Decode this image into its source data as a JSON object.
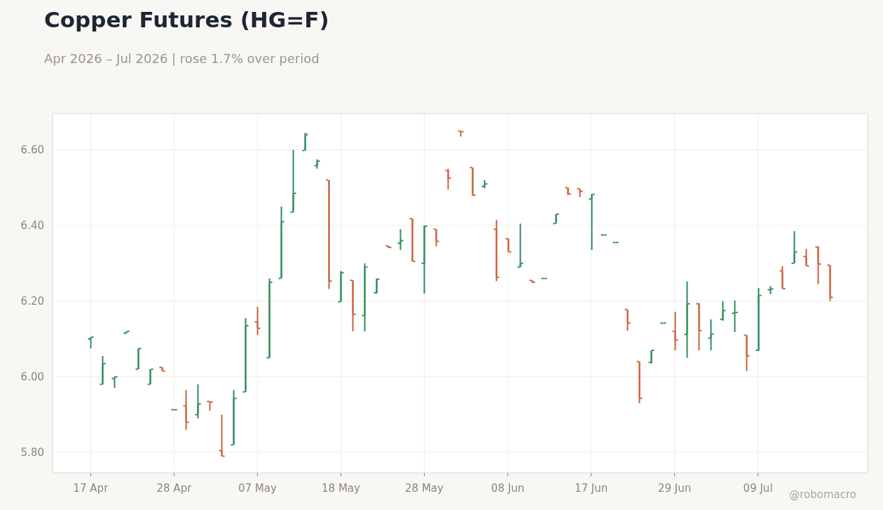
{
  "title": "Copper Futures (HG=F)",
  "subtitle": "Apr 2026 – Jul 2026 | rose 1.7% over period",
  "chart_data": {
    "type": "candlestick",
    "categories": [
      "17 Apr",
      null,
      null,
      null,
      null,
      null,
      null,
      "28 Apr",
      null,
      null,
      null,
      null,
      null,
      null,
      "07 May",
      null,
      null,
      null,
      null,
      null,
      null,
      "18 May",
      null,
      null,
      null,
      null,
      null,
      null,
      "28 May",
      null,
      null,
      null,
      null,
      null,
      null,
      "08 Jun",
      null,
      null,
      null,
      null,
      null,
      null,
      "17 Jun",
      null,
      null,
      null,
      null,
      null,
      null,
      "29 Jun",
      null,
      null,
      null,
      null,
      null,
      null,
      "09 Jul",
      null,
      null,
      null,
      null,
      null,
      null
    ],
    "series": [
      {
        "ohlc": [
          [
            6.1,
            6.105,
            6.075,
            6.105
          ],
          [
            5.98,
            6.055,
            5.98,
            6.035
          ],
          [
            5.995,
            6.0,
            5.97,
            6.0
          ],
          [
            6.115,
            6.12,
            6.115,
            6.12
          ],
          [
            6.02,
            6.075,
            6.02,
            6.075
          ],
          [
            5.98,
            6.02,
            5.98,
            6.02
          ],
          [
            6.025,
            6.025,
            6.015,
            6.015
          ],
          [
            5.913,
            5.914,
            5.912,
            5.913
          ],
          [
            5.923,
            5.965,
            5.86,
            5.88
          ],
          [
            5.9,
            5.98,
            5.89,
            5.928
          ],
          [
            5.935,
            5.935,
            5.91,
            5.933
          ],
          [
            5.805,
            5.9,
            5.79,
            5.79
          ],
          [
            5.82,
            5.965,
            5.82,
            5.943
          ],
          [
            5.96,
            6.155,
            5.96,
            6.135
          ],
          [
            6.145,
            6.185,
            6.11,
            6.128
          ],
          [
            6.05,
            6.26,
            6.05,
            6.25
          ],
          [
            6.26,
            6.45,
            6.26,
            6.41
          ],
          [
            6.435,
            6.6,
            6.435,
            6.485
          ],
          [
            6.598,
            6.645,
            6.598,
            6.64
          ],
          [
            6.558,
            6.575,
            6.55,
            6.57
          ],
          [
            6.52,
            6.52,
            6.232,
            6.253
          ],
          [
            6.198,
            6.28,
            6.198,
            6.275
          ],
          [
            6.255,
            6.255,
            6.12,
            6.165
          ],
          [
            6.162,
            6.3,
            6.12,
            6.29
          ],
          [
            6.222,
            6.26,
            6.22,
            6.258
          ],
          [
            6.346,
            6.346,
            6.34,
            6.342
          ],
          [
            6.353,
            6.39,
            6.335,
            6.36
          ],
          [
            6.418,
            6.418,
            6.305,
            6.305
          ],
          [
            6.3,
            6.4,
            6.22,
            6.398
          ],
          [
            6.39,
            6.39,
            6.345,
            6.358
          ],
          [
            6.545,
            6.55,
            6.495,
            6.525
          ],
          [
            6.65,
            6.65,
            6.635,
            6.648
          ],
          [
            6.553,
            6.553,
            6.478,
            6.48
          ],
          [
            6.503,
            6.52,
            6.498,
            6.51
          ],
          [
            6.39,
            6.415,
            6.253,
            6.263
          ],
          [
            6.365,
            6.365,
            6.33,
            6.33
          ],
          [
            6.29,
            6.405,
            6.29,
            6.3
          ],
          [
            6.255,
            6.255,
            6.248,
            6.25
          ],
          [
            6.26,
            6.261,
            6.259,
            6.26
          ],
          [
            6.405,
            6.43,
            6.405,
            6.43
          ],
          [
            6.5,
            6.5,
            6.48,
            6.483
          ],
          [
            6.497,
            6.497,
            6.475,
            6.49
          ],
          [
            6.47,
            6.483,
            6.335,
            6.482
          ],
          [
            6.375,
            6.376,
            6.374,
            6.375
          ],
          [
            6.355,
            6.356,
            6.354,
            6.355
          ],
          [
            6.178,
            6.178,
            6.122,
            6.142
          ],
          [
            6.04,
            6.04,
            5.93,
            5.943
          ],
          [
            6.038,
            6.07,
            6.035,
            6.07
          ],
          [
            6.142,
            6.143,
            6.141,
            6.142
          ],
          [
            6.12,
            6.172,
            6.07,
            6.097
          ],
          [
            6.112,
            6.252,
            6.05,
            6.193
          ],
          [
            6.193,
            6.195,
            6.07,
            6.122
          ],
          [
            6.102,
            6.152,
            6.07,
            6.113
          ],
          [
            6.152,
            6.2,
            6.148,
            6.175
          ],
          [
            6.168,
            6.202,
            6.118,
            6.17
          ],
          [
            6.11,
            6.11,
            6.015,
            6.055
          ],
          [
            6.07,
            6.235,
            6.068,
            6.215
          ],
          [
            6.23,
            6.24,
            6.218,
            6.232
          ],
          [
            6.28,
            6.292,
            6.232,
            6.233
          ],
          [
            6.3,
            6.385,
            6.3,
            6.33
          ],
          [
            6.318,
            6.338,
            6.293,
            6.293
          ],
          [
            6.343,
            6.345,
            6.245,
            6.298
          ],
          [
            6.295,
            6.295,
            6.2,
            6.21
          ]
        ]
      }
    ],
    "ylim": [
      5.746,
      6.696
    ],
    "grid": true,
    "yticks": [
      {
        "value": 5.8,
        "label": "5.80"
      },
      {
        "value": 6.0,
        "label": "6.00"
      },
      {
        "value": 6.2,
        "label": "6.20"
      },
      {
        "value": 6.4,
        "label": "6.40"
      },
      {
        "value": 6.6,
        "label": "6.60"
      }
    ]
  },
  "credit": "@robomacro"
}
